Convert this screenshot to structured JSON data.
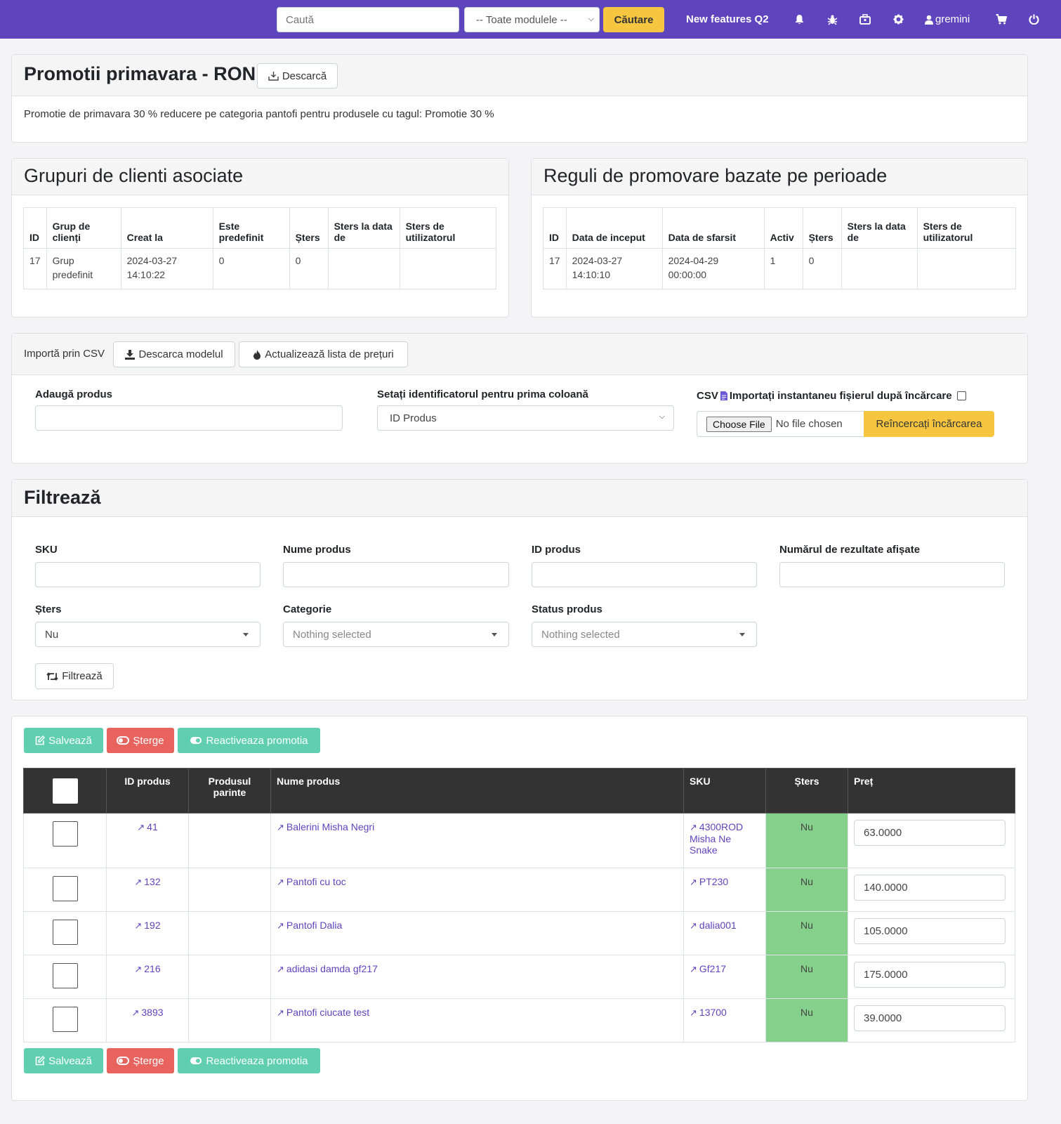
{
  "nav": {
    "search_placeholder": "Caută",
    "module_select": "-- Toate modulele --",
    "search_button": "Căutare",
    "new_features": "New features Q2",
    "username": "gremini"
  },
  "promo": {
    "title": "Promotii primavara - RON",
    "download_label": "Descarcă",
    "description": "Promotie de primavara 30 % reducere pe categoria pantofi pentru produsele cu tagul: Promotie 30 %"
  },
  "groups": {
    "title": "Grupuri de clienti asociate",
    "headers": [
      "ID",
      "Grup de clienți",
      "Creat la",
      "Este predefinit",
      "Șters",
      "Sters la data de",
      "Sters de utilizatorul"
    ],
    "rows": [
      [
        "17",
        "Grup predefinit",
        "2024-03-27 14:10:22",
        "0",
        "0",
        "",
        ""
      ]
    ]
  },
  "periods": {
    "title": "Reguli de promovare bazate pe perioade",
    "headers": [
      "ID",
      "Data de inceput",
      "Data de sfarsit",
      "Activ",
      "Șters",
      "Sters la data de",
      "Sters de utilizatorul"
    ],
    "rows": [
      [
        "17",
        "2024-03-27 14:10:10",
        "2024-04-29 00:00:00",
        "1",
        "0",
        "",
        ""
      ]
    ]
  },
  "import": {
    "label": "Importă prin CSV",
    "download_model": "Descarca modelul",
    "update_prices": "Actualizează lista de prețuri",
    "add_product_label": "Adaugă produs",
    "identifier_label": "Setați identificatorul pentru prima coloană",
    "identifier_value": "ID Produs",
    "csv_label": "CSV",
    "instant_import_label": "Importați instantaneu fișierul după încărcare",
    "choose_file": "Choose File",
    "no_file": "No file chosen",
    "retry_upload": "Reîncercați încărcarea"
  },
  "filter": {
    "title": "Filtrează",
    "sku_label": "SKU",
    "name_label": "Nume produs",
    "id_label": "ID produs",
    "results_label": "Numărul de rezultate afișate",
    "deleted_label": "Șters",
    "deleted_value": "Nu",
    "category_label": "Categorie",
    "category_value": "Nothing selected",
    "status_label": "Status produs",
    "status_value": "Nothing selected",
    "filter_button": "Filtrează"
  },
  "actions": {
    "save": "Salvează",
    "delete": "Șterge",
    "reactivate": "Reactiveaza promotia"
  },
  "products": {
    "headers": [
      "ID produs",
      "Produsul parinte",
      "Nume produs",
      "SKU",
      "Șters",
      "Preț"
    ],
    "rows": [
      {
        "id": "41",
        "parent": "",
        "name": "Balerini Misha Negri",
        "sku": "4300ROD Misha Ne Snake",
        "deleted": "Nu",
        "price": "63.0000"
      },
      {
        "id": "132",
        "parent": "",
        "name": "Pantofi cu toc",
        "sku": "PT230",
        "deleted": "Nu",
        "price": "140.0000"
      },
      {
        "id": "192",
        "parent": "",
        "name": "Pantofi Dalia",
        "sku": "dalia001",
        "deleted": "Nu",
        "price": "105.0000"
      },
      {
        "id": "216",
        "parent": "",
        "name": "adidasi damda gf217",
        "sku": "Gf217",
        "deleted": "Nu",
        "price": "175.0000"
      },
      {
        "id": "3893",
        "parent": "",
        "name": "Pantofi ciucate test",
        "sku": "13700",
        "deleted": "Nu",
        "price": "39.0000"
      }
    ]
  },
  "colors": {
    "navbar": "#5e44bd",
    "accent_yellow": "#f7c640",
    "teal": "#5fcfb0",
    "red": "#e9635e",
    "deleted_cell": "#85d18b",
    "table_header": "#333333"
  }
}
